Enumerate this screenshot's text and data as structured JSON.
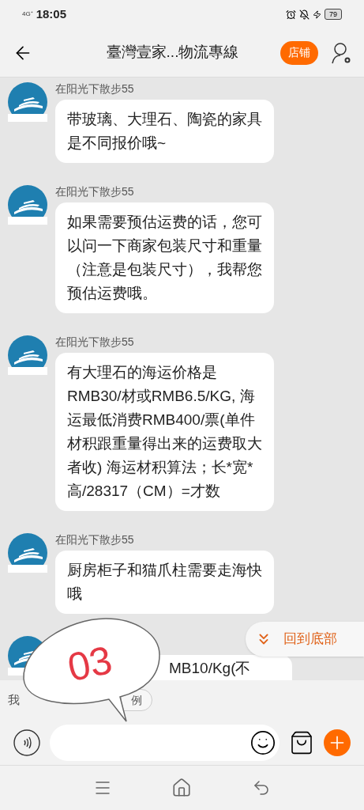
{
  "status_bar": {
    "network": "4G⁺",
    "time": "18:05",
    "battery": "79"
  },
  "header": {
    "title": "臺灣壹家...物流專線",
    "shop_button": "店铺"
  },
  "messages": [
    {
      "kind": "full",
      "sender": "在阳光下散步55",
      "lines": [
        "带玻璃、大理石、陶瓷的家具",
        "是不同报价哦~"
      ]
    },
    {
      "kind": "full",
      "sender": "在阳光下散步55",
      "lines": [
        "如果需要预估运费的话，您可",
        "以问一下商家包装尺寸和重量",
        "（注意是包装尺寸），我帮您",
        "预估运费哦。"
      ]
    },
    {
      "kind": "full",
      "sender": "在阳光下散步55",
      "lines": [
        "有大理石的海运价格是",
        "RMB30/材或RMB6.5/KG, 海",
        "运最低消费RMB400/票(单件",
        "材积跟重量得出来的运费取大",
        "者收) 海运材积算法；长*宽*",
        "高/28317（CM）=才数"
      ]
    },
    {
      "kind": "full",
      "sender": "在阳光下散步55",
      "lines": [
        "厨房柜子和猫爪柱需要走海快",
        "哦"
      ]
    },
    {
      "kind": "partial",
      "lines": [
        "MB10/Kg(不"
      ]
    }
  ],
  "back_to_bottom": "回到底部",
  "quick_reply": {
    "label": "我",
    "chip": "例"
  },
  "sticker": "03"
}
